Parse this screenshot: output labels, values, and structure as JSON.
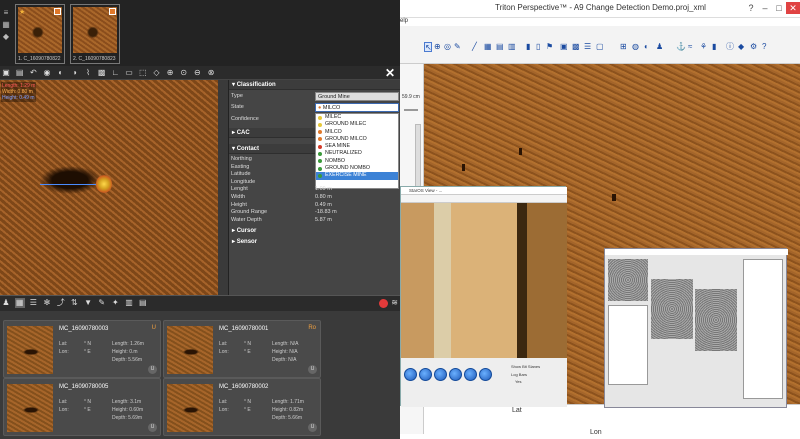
{
  "left_app": {
    "thumbnails": [
      {
        "caption": "1. C_16090780822"
      },
      {
        "caption": "2. C_16090780823"
      }
    ],
    "readout": {
      "line1": "Length: 1.29 m",
      "line2": "Width: 0.80 m",
      "line3": "Height: 0.49 m"
    },
    "properties": {
      "classification_header": "Classification",
      "type_label": "Type",
      "type_value": "Ground Mine",
      "state_label": "State",
      "state_value": "MILCO",
      "confidence_label": "Confidence",
      "cac_header": "CAC",
      "contact_header": "Contact",
      "contact_rows": [
        {
          "label": "Northing",
          "value": ""
        },
        {
          "label": "Easting",
          "value": ""
        },
        {
          "label": "Latitude",
          "value": ""
        },
        {
          "label": "Longitude",
          "value": ""
        },
        {
          "label": "Lenght",
          "value": "1.09 m"
        },
        {
          "label": "Width",
          "value": "0.80 m"
        },
        {
          "label": "Height",
          "value": "0.49 m"
        },
        {
          "label": "Ground Range",
          "value": "-18.83 m"
        },
        {
          "label": "Water Depth",
          "value": "5.87 m"
        }
      ],
      "cursor_header": "Cursor",
      "sensor_header": "Sensor",
      "state_options": [
        {
          "label": "MILEC",
          "color": "#e6c83a"
        },
        {
          "label": "GROUND MILEC",
          "color": "#e6c83a"
        },
        {
          "label": "MILCO",
          "color": "#e0782a"
        },
        {
          "label": "GROUND MILCO",
          "color": "#e0782a"
        },
        {
          "label": "SEA MINE",
          "color": "#d43a2a"
        },
        {
          "label": "NEUTRALIZED",
          "color": "#3a9a3a"
        },
        {
          "label": "NOMBO",
          "color": "#3a9a3a"
        },
        {
          "label": "GROUND NOMBO",
          "color": "#3a9a3a"
        },
        {
          "label": "EXERCISE MINE",
          "color": "#3a9a3a"
        }
      ],
      "selected_option": "EXERCISE MINE"
    },
    "cards": [
      {
        "title": "MC_16090780003",
        "status": "U",
        "lat": "Lat:",
        "lon": "Lon:",
        "n": "° N",
        "e": "° E",
        "length": "Length: 1.26m",
        "height": "Height: 0.m",
        "depth": "Depth: 5.56m"
      },
      {
        "title": "MC_16090780001",
        "status": "Ro",
        "lat": "Lat:",
        "lon": "Lon:",
        "n": "° N",
        "e": "° E",
        "length": "Length: N/A",
        "height": "Height: N/A",
        "depth": "Depth: N/A"
      },
      {
        "title": "MC_16090780005",
        "status": "",
        "lat": "Lat:",
        "lon": "Lon:",
        "n": "° N",
        "e": "° E",
        "length": "Length: 3.1m",
        "height": "Height: 0.60m",
        "depth": "Depth: 5.69m"
      },
      {
        "title": "MC_16090780002",
        "status": "",
        "lat": "Lat:",
        "lon": "Lon:",
        "n": "° N",
        "e": "° E",
        "length": "Length: 1.71m",
        "height": "Height: 0.82m",
        "depth": "Depth: 5.66m"
      }
    ],
    "card_button": "U"
  },
  "right_app": {
    "title": "Triton Perspective™ - A9 Change Detection Demo.proj_xml",
    "menu_fragment": "elp",
    "left_value": "59.9 cm",
    "status_labels": {
      "lat": "Lat",
      "lon": "Lon"
    },
    "sub_window_title": "StarOS View - ...",
    "sub_window_ctrl_label1": "Show Bit Slanes",
    "sub_window_ctrl_label2": "Log Bars",
    "sub_window_ctrl_label3": "Yes"
  }
}
